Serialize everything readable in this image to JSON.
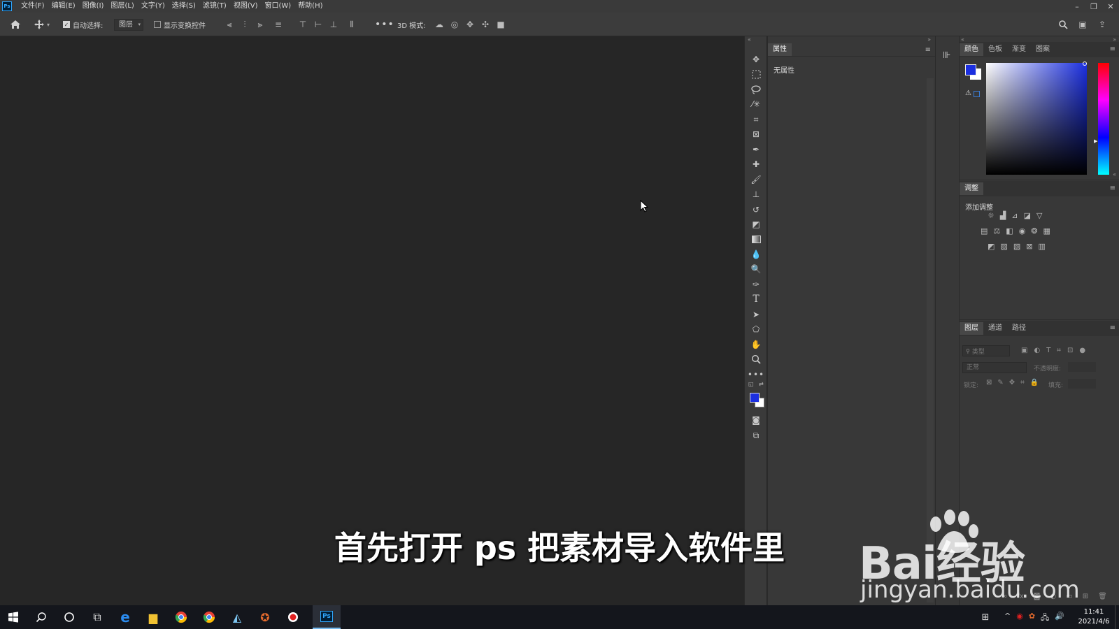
{
  "app": {
    "logo": "Ps"
  },
  "menu": [
    "文件(F)",
    "编辑(E)",
    "图像(I)",
    "图层(L)",
    "文字(Y)",
    "选择(S)",
    "滤镜(T)",
    "视图(V)",
    "窗口(W)",
    "帮助(H)"
  ],
  "window_controls": {
    "minimize": "–",
    "restore": "❐",
    "close": "✕"
  },
  "options_bar": {
    "auto_select_label": "自动选择:",
    "auto_select_value": "图层",
    "show_transform_label": "显示变换控件",
    "mode_3d_label": "3D 模式:"
  },
  "properties_panel": {
    "tab": "属性",
    "empty_text": "无属性"
  },
  "color_panel": {
    "tabs": [
      "颜色",
      "色板",
      "渐变",
      "图案"
    ],
    "foreground_color": "#1b2fe0",
    "background_color": "#ffffff"
  },
  "adjustments_panel": {
    "tab": "调整",
    "add_label": "添加调整"
  },
  "layers_panel": {
    "tabs": [
      "图层",
      "通道",
      "路径"
    ],
    "search_placeholder": "类型",
    "blend_mode": "正常",
    "opacity_label": "不透明度:",
    "lock_label": "锁定:",
    "fill_label": "填充:"
  },
  "subtitle": "首先打开 ps 把素材导入软件里",
  "watermark": {
    "brand": "Bai经验",
    "url": "jingyan.baidu.com"
  },
  "taskbar": {
    "time": "11:41",
    "date": "2021/4/6",
    "active_app": "Ps"
  }
}
